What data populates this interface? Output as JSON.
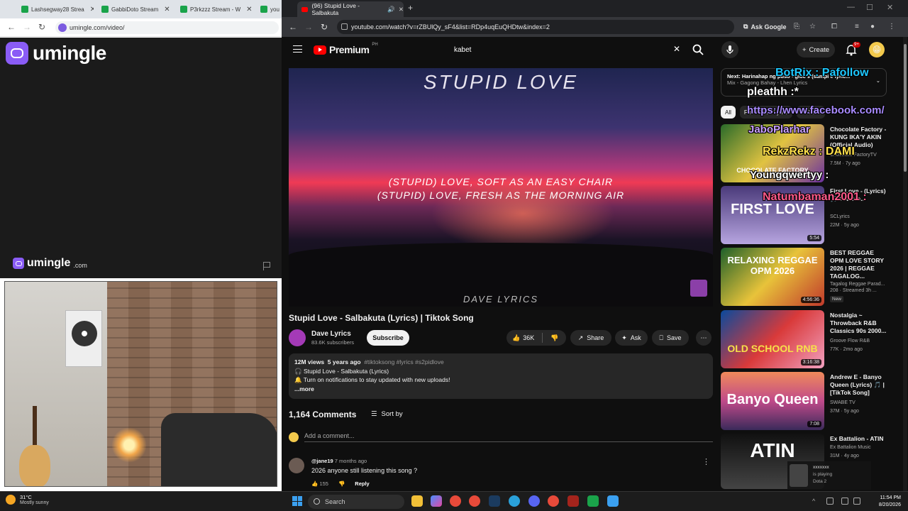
{
  "left_browser": {
    "tabs": [
      {
        "label": "Lashsegway28 Strea"
      },
      {
        "label": "GabbiDoto Stream"
      },
      {
        "label": "P3rkzzz Stream - W"
      },
      {
        "label": "you"
      }
    ],
    "url": "umingle.com/video/"
  },
  "umingle": {
    "logo_text": "umingle",
    "small_logo_text": "umingle",
    "small_logo_domain": ".com"
  },
  "right_browser": {
    "tab_title": "(96) Stupid Love - Salbakuta",
    "url": "youtube.com/watch?v=rZBUlQy_sF4&list=RDp4uqEuQHDtw&index=2",
    "ask_google": "Ask Google"
  },
  "youtube": {
    "logo_word": "Premium",
    "region": "PH",
    "search_value": "kabet",
    "create_label": "Create",
    "notif_badge": "9+",
    "video": {
      "overlay_title": "STUPID LOVE",
      "lyric_line1": "(STUPID) LOVE, SOFT AS AN EASY CHAIR",
      "lyric_line2": "(STUPID) LOVE, FRESH AS THE MORNING AIR",
      "overlay_channel": "DAVE LYRICS"
    },
    "title": "Stupid Love - Salbakuta (Lyrics) | Tiktok Song",
    "channel": {
      "name": "Dave Lyrics",
      "subscribers": "83.6K subscribers"
    },
    "subscribe_label": "Subscribe",
    "likes": "36K",
    "share_label": "Share",
    "ask_label": "Ask",
    "save_label": "Save",
    "description": {
      "views": "12M views",
      "age": "5 years ago",
      "tags": "#tiktoksong #lyrics #s2pidlove",
      "line1": "🎧 Stupid Love - Salbakuta (Lyrics)",
      "line2": "🔔 Turn on notifications to stay updated with new uploads!",
      "more": "...more"
    },
    "comments": {
      "count": "1,164 Comments",
      "sort_label": "Sort by",
      "add_placeholder": "Add a comment...",
      "first": {
        "author": "@jane19",
        "time": "7 months ago",
        "text": "2026 anyone still listening this song ?",
        "likes": "155",
        "reply_label": "Reply"
      }
    },
    "sidebar": {
      "up_next_label": "Next: Harinahap ng puso - gloc 9 (sampi e lyric...",
      "up_next_sub": "Mix - Gagong Bahay - Lhen Lyrics",
      "chips": [
        "All",
        "From Dave Lyrics",
        "Related"
      ],
      "recs": [
        {
          "title": "Chocolate Factory - KUNG IKA'Y AKIN (Official Audio)",
          "channel": "Chocolate FactoryTV",
          "meta": "7.5M · 7y ago",
          "thumb_text": "CHOCOLATE FACTORY",
          "duration": ""
        },
        {
          "title": "First Love - (Lyrics) 🎵 You are...",
          "channel": "SCLyrics",
          "meta": "22M · 5y ago",
          "thumb_text": "FIRST LOVE",
          "duration": "5:54"
        },
        {
          "title": "BEST REGGAE OPM LOVE STORY 2026 | REGGAE TAGALOG...",
          "channel": "Tagalog Reggae Parad...",
          "meta": "208 · Streamed 3h ...",
          "badge": "New",
          "thumb_text": "RELAXING REGGAE OPM 2026",
          "duration": "4:56:36"
        },
        {
          "title": "Nostalgia ~ Throwback R&B Classics 90s 2000...",
          "channel": "Groove Flow R&B",
          "meta": "77K · 2mo ago",
          "thumb_text": "OLD SCHOOL RNB",
          "duration": "3:16:38"
        },
        {
          "title": "Andrew E - Banyo Queen (Lyrics) 🎵 | [TikTok Song]",
          "channel": "SWABE TV",
          "meta": "37M · 5y ago",
          "thumb_text": "Banyo Queen",
          "duration": "7:08"
        },
        {
          "title": "Ex Battalion - ATIN",
          "channel": "Ex Battalion Music",
          "meta": "31M · 4y ago",
          "thumb_text": "ATIN",
          "duration": ""
        }
      ]
    }
  },
  "stream_chat": [
    {
      "text": "BotRix : Pafollow",
      "color": "#1ec8ff"
    },
    {
      "text": "pleathh :*",
      "color": "#ffffff"
    },
    {
      "text": "https://www.facebook.com/",
      "color": "#a98bff"
    },
    {
      "text": "JaboPlarhar",
      "color": "#c9a0ff"
    },
    {
      "text": "RekzRekz : DAMI",
      "color": "#ffe04b"
    },
    {
      "text": "Youngqwertyy :",
      "color": "#ffffff"
    },
    {
      "text": "Natumbaman2001 :",
      "color": "#ff5a8a"
    }
  ],
  "dota_widget": {
    "user": "xxxxxxx",
    "status": "is playing",
    "game": "Dota 2"
  },
  "taskbar": {
    "temp": "31°C",
    "weather": "Mostly sunny",
    "search_label": "Search",
    "time": "11:54 PM",
    "date": "8/20/2026"
  }
}
